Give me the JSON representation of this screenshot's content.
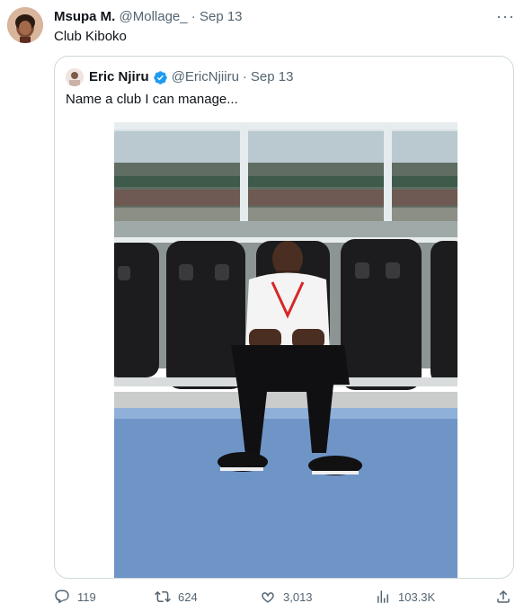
{
  "tweet": {
    "author_name": "Msupa M.",
    "author_handle": "@Mollage_",
    "separator": "·",
    "date": "Sep 13",
    "text": "Club Kiboko",
    "more_icon": "more-icon"
  },
  "quoted": {
    "author_name": "Eric Njiru",
    "author_handle": "@EricNjiiru",
    "separator": "·",
    "date": "Sep 13",
    "text": "Name a club I can manage...",
    "verified_icon": "verified-badge-icon",
    "verified_color": "#1d9bf0"
  },
  "actions": {
    "reply_count": "119",
    "retweet_count": "624",
    "like_count": "3,013",
    "views_count": "103.3K"
  },
  "colors": {
    "muted": "#536471",
    "border": "#cfd9de",
    "accent": "#1d9bf0"
  }
}
